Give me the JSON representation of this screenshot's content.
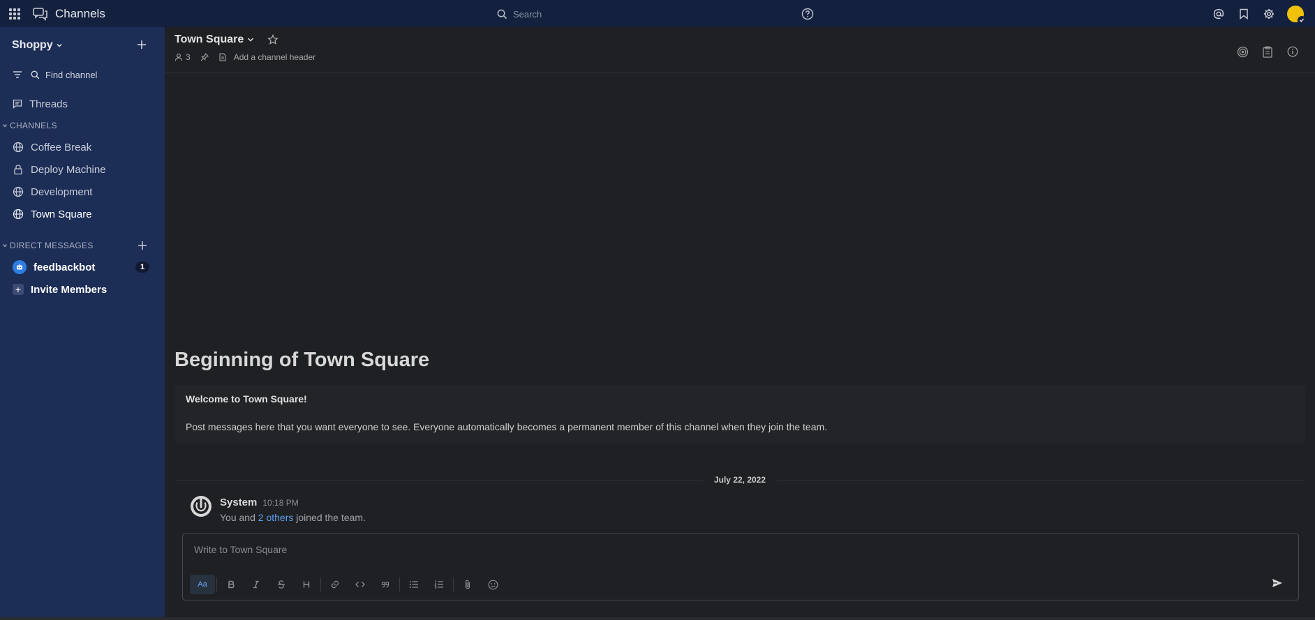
{
  "global_header": {
    "product_name": "Channels",
    "search_placeholder": "Search"
  },
  "sidebar": {
    "team_name": "Shoppy",
    "find_channel": "Find channel",
    "threads_label": "Threads",
    "channels_section": "CHANNELS",
    "channels": [
      {
        "label": "Coffee Break",
        "icon": "globe-icon"
      },
      {
        "label": "Deploy Machine",
        "icon": "lock-icon"
      },
      {
        "label": "Development",
        "icon": "globe-icon"
      },
      {
        "label": "Town Square",
        "icon": "globe-icon",
        "active": true
      }
    ],
    "dm_section": "DIRECT MESSAGES",
    "dms": [
      {
        "label": "feedbackbot",
        "badge": "1"
      }
    ],
    "invite_label": "Invite Members"
  },
  "channel_header": {
    "title": "Town Square",
    "member_count": "3",
    "header_placeholder": "Add a channel header"
  },
  "intro": {
    "title": "Beginning of Town Square",
    "welcome": "Welcome to Town Square!",
    "description": "Post messages here that you want everyone to see. Everyone automatically becomes a permanent member of this channel when they join the team."
  },
  "messages": {
    "date_separator": "July 22, 2022",
    "post": {
      "user": "System",
      "time": "10:18 PM",
      "text_prefix": "You and",
      "link_text": "2 others",
      "text_suffix": "joined the team."
    }
  },
  "composer": {
    "placeholder": "Write to Town Square",
    "format_toggle": "Aa"
  },
  "colors": {
    "global_header_bg": "#14213e",
    "sidebar_bg": "#1c2d56",
    "center_bg": "#1f2023",
    "link": "#5d9ff0",
    "avatar": "#f0c20a"
  }
}
